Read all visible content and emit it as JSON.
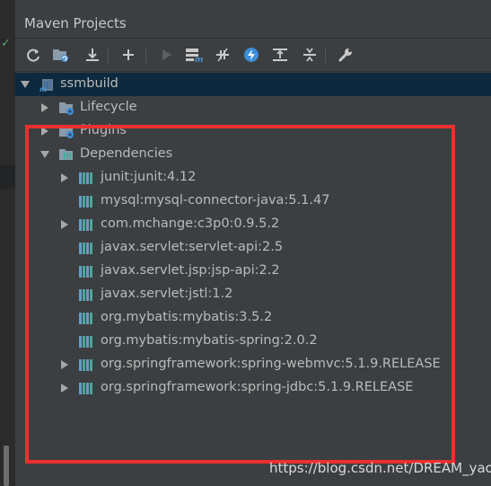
{
  "window": {
    "title": "Maven Projects"
  },
  "toolbar": {
    "buttons": [
      "reimport-icon",
      "generate-sources-icon",
      "download-icon",
      "add-icon",
      "run-icon",
      "execute-goal-icon",
      "toggle-offline-icon",
      "skip-tests-icon",
      "show-dependencies-icon",
      "collapse-all-icon",
      "settings-wrench-icon"
    ]
  },
  "tree": {
    "root": {
      "label": "ssmbuild",
      "expanded": true
    },
    "lifecycle": {
      "label": "Lifecycle",
      "expanded": false
    },
    "plugins": {
      "label": "Plugins",
      "expanded": false
    },
    "dependencies": {
      "label": "Dependencies",
      "expanded": true
    },
    "items": [
      {
        "label": "junit:junit:4.12",
        "expandable": true
      },
      {
        "label": "mysql:mysql-connector-java:5.1.47",
        "expandable": false
      },
      {
        "label": "com.mchange:c3p0:0.9.5.2",
        "expandable": true
      },
      {
        "label": "javax.servlet:servlet-api:2.5",
        "expandable": false
      },
      {
        "label": "javax.servlet.jsp:jsp-api:2.2",
        "expandable": false
      },
      {
        "label": "javax.servlet:jstl:1.2",
        "expandable": false
      },
      {
        "label": "org.mybatis:mybatis:3.5.2",
        "expandable": false
      },
      {
        "label": "org.mybatis:mybatis-spring:2.0.2",
        "expandable": false
      },
      {
        "label": "org.springframework:spring-webmvc:5.1.9.RELEASE",
        "expandable": true
      },
      {
        "label": "org.springframework:spring-jdbc:5.1.9.RELEASE",
        "expandable": true
      }
    ]
  },
  "watermark": "https://blog.csdn.net/DREAM_yao",
  "colors": {
    "background": "#3c3f41",
    "selection": "#0d293e",
    "highlight_border": "#ed2f2f",
    "text": "#bbbbbb"
  }
}
